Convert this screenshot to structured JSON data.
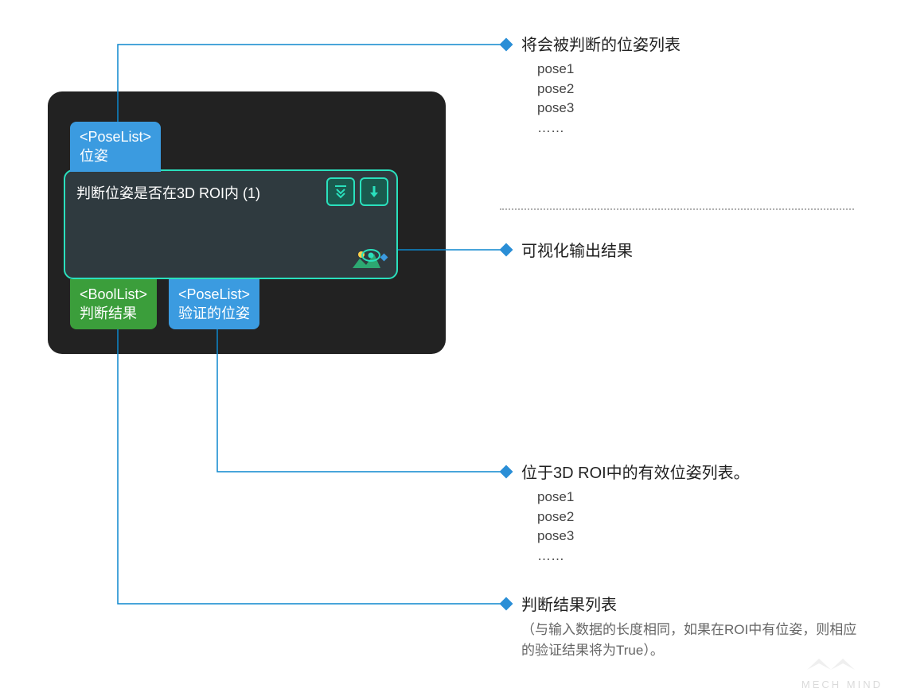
{
  "node": {
    "input_port": {
      "type": "<PoseList>",
      "label": "位姿"
    },
    "title": "判断位姿是否在3D ROI内 (1)",
    "output_port_1": {
      "type": "<BoolList>",
      "label": "判断结果"
    },
    "output_port_2": {
      "type": "<PoseList>",
      "label": "验证的位姿"
    }
  },
  "annotations": {
    "anno1": {
      "title": "将会被判断的位姿列表",
      "items": "pose1\npose2\npose3\n……"
    },
    "anno2": {
      "title": "可视化输出结果"
    },
    "anno3": {
      "title": "位于3D ROI中的有效位姿列表。",
      "items": "pose1\npose2\npose3\n……"
    },
    "anno4": {
      "title": "判断结果列表",
      "desc": "（与输入数据的长度相同，如果在ROI中有位姿，则相应的验证结果将为True）。"
    }
  },
  "watermark": "MECH MIND",
  "colors": {
    "blue_port": "#3b9be0",
    "green_port": "#3b9e3b",
    "node_border": "#2ae0bd",
    "node_bg": "#2f3a3f",
    "panel_bg": "#222222",
    "connector": "#0d87cd",
    "bullet": "#2a8ed6"
  }
}
